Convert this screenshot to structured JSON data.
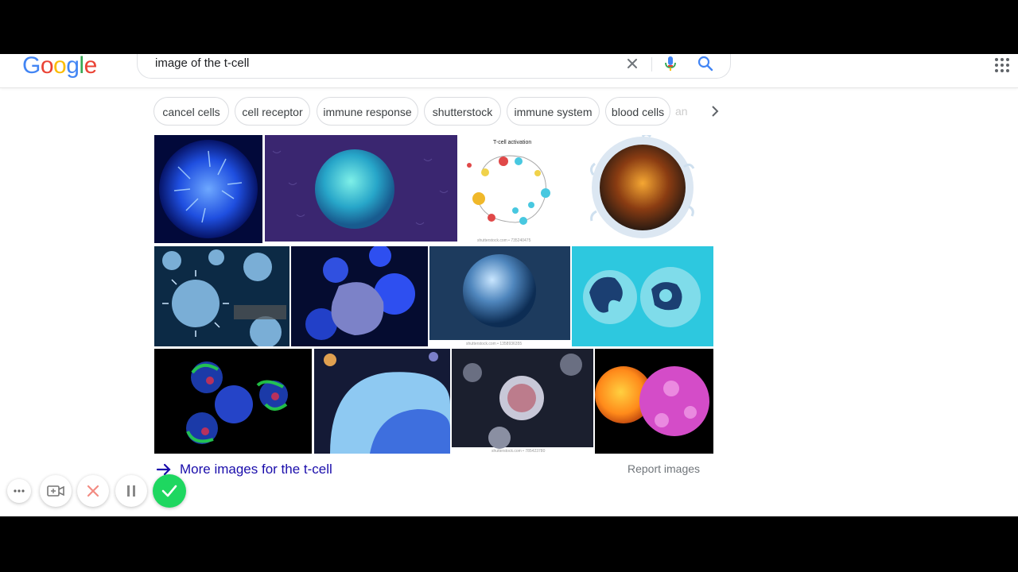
{
  "search": {
    "query": "image of the t-cell",
    "logo_text": "Google"
  },
  "chips": [
    "cancel cells",
    "cell receptor",
    "immune response",
    "shutterstock",
    "immune system",
    "blood cells",
    "an"
  ],
  "images": {
    "diagram_title": "T-cell activation",
    "watermarks": [
      "shutterstock.com • 735240475",
      "shutterstock.com • 1358936355",
      "shutterstock.com • 785423780"
    ]
  },
  "footer": {
    "more_label": "More images for the t-cell",
    "report_label": "Report images"
  },
  "colors": {
    "link": "#1a0dab",
    "confirm": "#1ed760",
    "cancel": "#f28b82"
  }
}
